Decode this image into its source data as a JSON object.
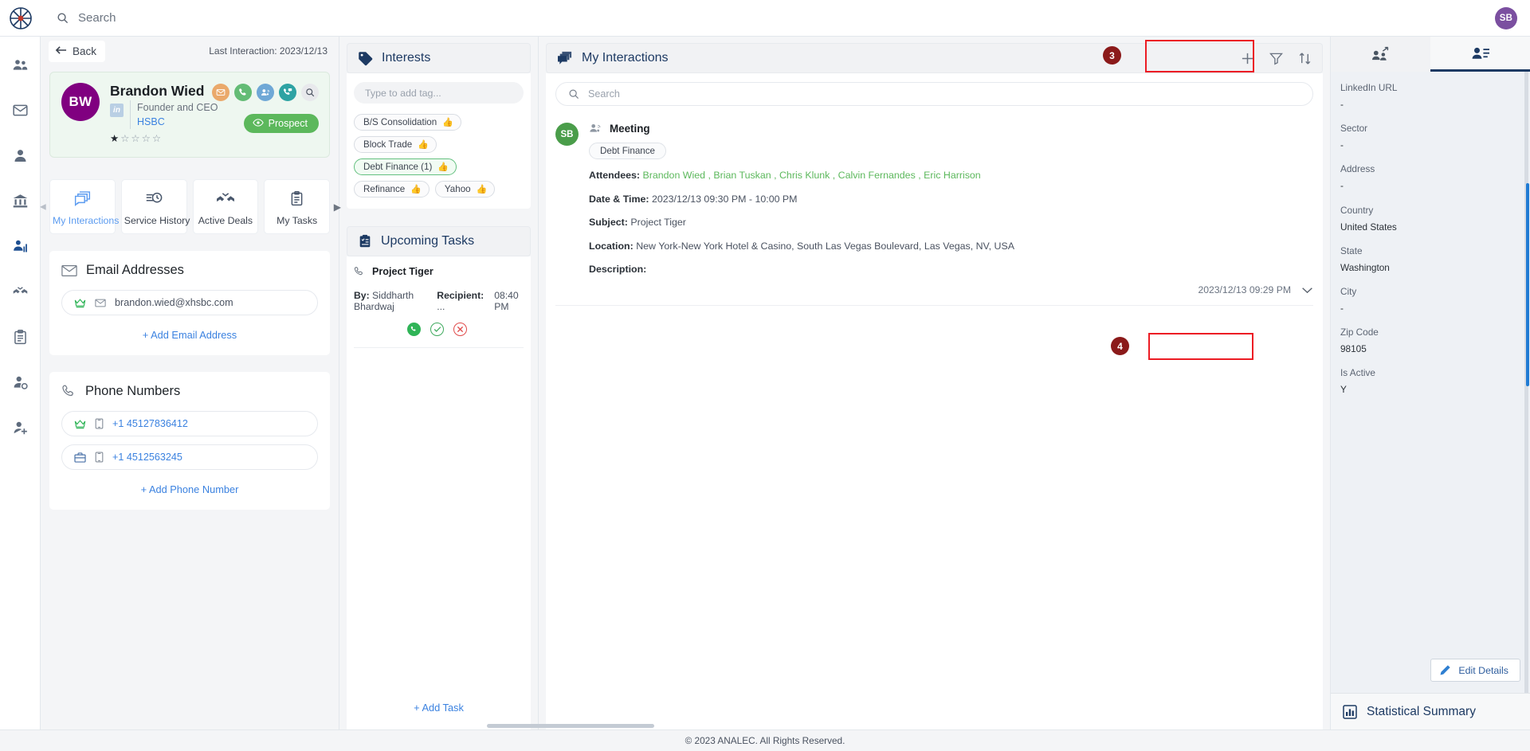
{
  "topbar": {
    "search_placeholder": "Search",
    "search_value": "",
    "user_initials": "SB",
    "search_icon": "search-icon",
    "logo_icon": "analec-logo-icon"
  },
  "rail": {
    "items": [
      {
        "icon": "people-group-icon",
        "name": "contacts-nav",
        "active": false
      },
      {
        "icon": "envelope-icon",
        "name": "mail-nav",
        "active": false
      },
      {
        "icon": "person-icon",
        "name": "person-nav",
        "active": false
      },
      {
        "icon": "bank-icon",
        "name": "institutions-nav",
        "active": false
      },
      {
        "icon": "analytics-person-icon",
        "name": "analytics-nav",
        "active": true
      },
      {
        "icon": "handshake-check-icon",
        "name": "deals-nav",
        "active": false
      },
      {
        "icon": "clipboard-list-icon",
        "name": "tasks-nav",
        "active": false
      },
      {
        "icon": "person-gear-icon",
        "name": "settings-person-nav",
        "active": false
      },
      {
        "icon": "person-add-icon",
        "name": "add-person-nav",
        "active": false
      }
    ]
  },
  "profile": {
    "back_label": "Back",
    "back_icon": "arrow-left-icon",
    "last_interaction": "Last Interaction: 2023/12/13",
    "initials": "BW",
    "name": "Brandon Wied",
    "role": "Founder and CEO",
    "organization": "HSBC",
    "linkedin_icon": "linkedin-icon",
    "rating": 1,
    "rating_max": 5,
    "status_label": "Prospect",
    "status_icon": "eye-icon",
    "actions": [
      {
        "icon": "email-icon",
        "name": "send-email-action"
      },
      {
        "icon": "phone-icon",
        "name": "call-action"
      },
      {
        "icon": "meeting-icon",
        "name": "meeting-action"
      },
      {
        "icon": "phone-message-icon",
        "name": "phone-message-action"
      },
      {
        "icon": "search-icon",
        "name": "search-action"
      }
    ]
  },
  "tabs": {
    "items": [
      {
        "label": "My Interactions",
        "icon": "chat-stack-icon",
        "active": true
      },
      {
        "label": "Service History",
        "icon": "clock-list-icon",
        "active": false
      },
      {
        "label": "Active Deals",
        "icon": "handshake-check-icon",
        "active": false
      },
      {
        "label": "My Tasks",
        "icon": "clipboard-icon",
        "active": false
      }
    ],
    "next_arrow_icon": "chevron-right-icon",
    "prev_arrow_icon": "chevron-left-icon"
  },
  "email_panel": {
    "title": "Email Addresses",
    "icon": "envelope-icon",
    "rows": [
      {
        "type_icon": "crown-icon",
        "kind_icon": "envelope-icon",
        "value": "brandon.wied@xhsbc.com"
      }
    ],
    "add_label": "+ Add Email Address"
  },
  "phone_panel": {
    "title": "Phone Numbers",
    "icon": "phone-icon",
    "rows": [
      {
        "type_icon": "crown-icon",
        "kind_icon": "mobile-icon",
        "value": "+1 45127836412"
      },
      {
        "type_icon": "briefcase-icon",
        "kind_icon": "mobile-icon",
        "value": "+1 4512563245"
      }
    ],
    "add_label": "+ Add Phone Number"
  },
  "interests": {
    "title": "Interests",
    "icon": "tag-icon",
    "input_placeholder": "Type to add tag...",
    "input_value": "",
    "tags": [
      {
        "label": "B/S Consolidation",
        "icon": "thumbs-up-icon",
        "highlighted": false
      },
      {
        "label": "Block Trade",
        "icon": "thumbs-up-icon",
        "highlighted": false
      },
      {
        "label": "Debt Finance (1)",
        "icon": "thumbs-up-icon",
        "highlighted": true
      },
      {
        "label": "Refinance",
        "icon": "thumbs-up-icon",
        "highlighted": false
      },
      {
        "label": "Yahoo",
        "icon": "thumbs-up-icon",
        "highlighted": false
      }
    ]
  },
  "upcoming_tasks": {
    "title": "Upcoming Tasks",
    "icon": "clipboard-check-icon",
    "task": {
      "name": "Project Tiger",
      "type_icon": "phone-icon",
      "by_label": "By:",
      "by_value": "Siddharth Bhardwaj",
      "recipient_label": "Recipient:",
      "recipient_value": "...",
      "time": "08:40 PM",
      "actions": [
        {
          "icon": "phone-icon",
          "name": "task-call-action"
        },
        {
          "icon": "check-icon",
          "name": "task-complete-action"
        },
        {
          "icon": "close-icon",
          "name": "task-cancel-action"
        }
      ]
    },
    "add_label": "+ Add Task"
  },
  "interactions": {
    "title": "My Interactions",
    "icon": "chat-stack-icon",
    "tools": [
      {
        "icon": "plus-icon",
        "name": "add-interaction-button"
      },
      {
        "icon": "filter-icon",
        "name": "filter-interactions-button"
      },
      {
        "icon": "sort-icon",
        "name": "sort-interactions-button"
      }
    ],
    "search_placeholder": "Search",
    "search_value": "",
    "items": [
      {
        "avatar_initials": "SB",
        "type_icon": "meeting-icon",
        "title": "Meeting",
        "tag": "Debt Finance",
        "attendees_label": "Attendees:",
        "attendees": "Brandon Wied , Brian Tuskan , Chris Klunk , Calvin Fernandes , Eric Harrison",
        "datetime_label": "Date & Time:",
        "datetime": "2023/12/13 09:30 PM - 10:00 PM",
        "subject_label": "Subject:",
        "subject": "Project Tiger",
        "location_label": "Location:",
        "location": "New York-New York Hotel & Casino, South Las Vegas Boulevard, Las Vegas, NV, USA",
        "description_label": "Description:",
        "description": "",
        "timestamp": "2023/12/13 09:29 PM",
        "expand_icon": "chevron-down-icon"
      }
    ]
  },
  "details": {
    "tabs": [
      {
        "icon": "org-chart-icon",
        "name": "relationship-tab",
        "active": false
      },
      {
        "icon": "contact-card-icon",
        "name": "details-tab",
        "active": true
      }
    ],
    "fields": [
      {
        "label": "LinkedIn URL",
        "value": "-"
      },
      {
        "label": "Sector",
        "value": "-"
      },
      {
        "label": "Address",
        "value": "-"
      },
      {
        "label": "Country",
        "value": "United States"
      },
      {
        "label": "State",
        "value": "Washington"
      },
      {
        "label": "City",
        "value": "-"
      },
      {
        "label": "Zip Code",
        "value": "98105"
      },
      {
        "label": "Is Active",
        "value": "Y"
      }
    ],
    "edit_label": "Edit Details",
    "edit_icon": "pencil-icon",
    "stat_label": "Statistical Summary",
    "stat_icon": "bar-chart-icon"
  },
  "annotations": [
    {
      "number": "3",
      "target": "details-tab"
    },
    {
      "number": "4",
      "target": "edit-details-button"
    }
  ],
  "footer": {
    "copyright": "© 2023 ANALEC. All Rights Reserved."
  },
  "colors": {
    "accent_blue": "#1d3a63",
    "link_blue": "#3b82e0",
    "green": "#5cb85c",
    "purple_avatar": "#800080",
    "marker_red": "#8b1a1a",
    "highlight_red": "#ec1c24"
  }
}
